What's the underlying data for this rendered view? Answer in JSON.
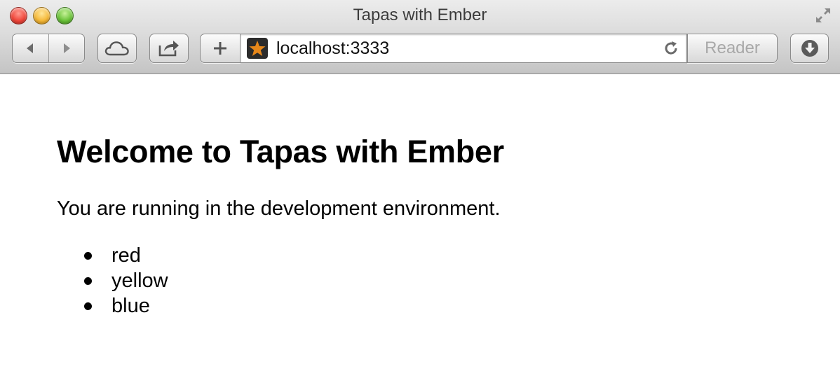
{
  "window": {
    "title": "Tapas with Ember"
  },
  "toolbar": {
    "url": "localhost:3333",
    "reader_label": "Reader",
    "icons": {
      "back": "back-arrow-icon",
      "forward": "forward-arrow-icon",
      "cloud": "cloud-icon",
      "share": "share-icon",
      "add": "plus-icon",
      "favicon": "star-favicon",
      "reload": "reload-icon",
      "download": "download-icon",
      "fullscreen": "fullscreen-icon"
    }
  },
  "page": {
    "heading": "Welcome to Tapas with Ember",
    "lead": "You are running in the development environment.",
    "colors": [
      "red",
      "yellow",
      "blue"
    ]
  },
  "theme": {
    "favicon_star": "#e6871a",
    "favicon_bg": "#2b2b2b"
  }
}
